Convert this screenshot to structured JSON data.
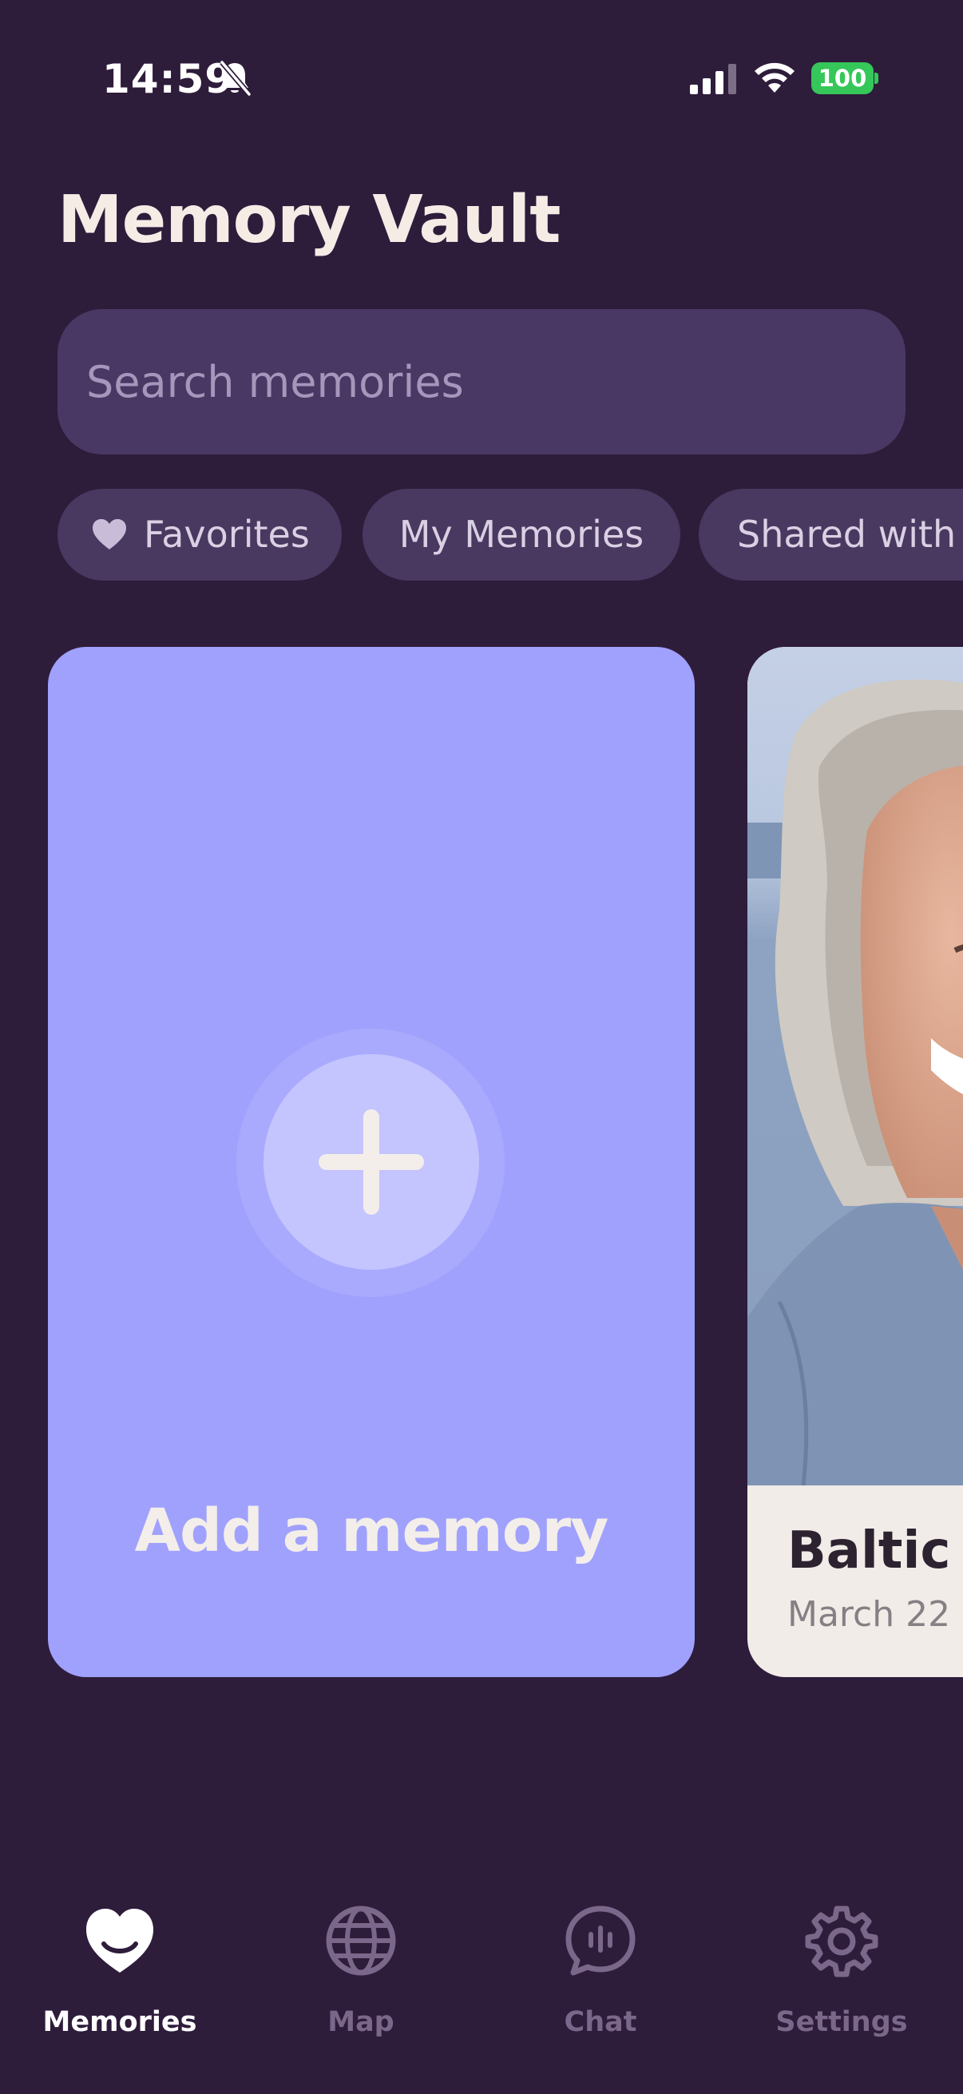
{
  "status_bar": {
    "time": "14:59",
    "battery": "100",
    "battery_color": "#35c759"
  },
  "header": {
    "title": "Memory Vault"
  },
  "search": {
    "placeholder": "Search memories",
    "value": ""
  },
  "filters": [
    {
      "label": "Favorites",
      "icon": "heart-icon"
    },
    {
      "label": "My Memories"
    },
    {
      "label": "Shared with"
    }
  ],
  "cards": {
    "add": {
      "label": "Add a memory",
      "icon": "plus-icon"
    },
    "memory": {
      "title": "Baltic S",
      "date": "March 22"
    }
  },
  "tabs": [
    {
      "label": "Memories",
      "icon": "heart-smile-icon",
      "active": true
    },
    {
      "label": "Map",
      "icon": "globe-icon",
      "active": false
    },
    {
      "label": "Chat",
      "icon": "chat-bubble-icon",
      "active": false
    },
    {
      "label": "Settings",
      "icon": "gear-icon",
      "active": false
    }
  ],
  "colors": {
    "background": "#2e1c3b",
    "search_bg": "#4a3864",
    "chip_bg": "#49385f",
    "add_card": "#a0a1fd",
    "memory_card": "#f1ece8",
    "tab_inactive": "#7a6789",
    "tab_active": "#ffffff"
  }
}
